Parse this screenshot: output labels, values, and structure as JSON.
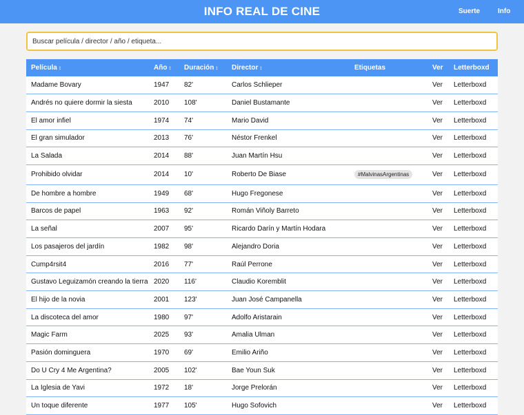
{
  "header": {
    "title": "INFO REAL DE CINE",
    "nav": [
      "Suerte",
      "Info"
    ]
  },
  "search": {
    "placeholder": "Buscar película / director / año / etiqueta..."
  },
  "table": {
    "columns": [
      {
        "label": "Película",
        "sortable": true
      },
      {
        "label": "Año",
        "sortable": true
      },
      {
        "label": "Duración",
        "sortable": true
      },
      {
        "label": "Director",
        "sortable": true
      },
      {
        "label": "Etiquetas",
        "sortable": false
      },
      {
        "label": "Ver",
        "sortable": false
      },
      {
        "label": "Letterboxd",
        "sortable": false
      }
    ],
    "sort_arrow": "↕",
    "rows": [
      {
        "title": "Madame Bovary",
        "year": "1947",
        "duration": "82'",
        "director": "Carlos Schlieper",
        "tags": [],
        "ver": "Ver",
        "letterboxd": "Letterboxd"
      },
      {
        "title": "Andrés no quiere dormir la siesta",
        "year": "2010",
        "duration": "108'",
        "director": "Daniel Bustamante",
        "tags": [],
        "ver": "Ver",
        "letterboxd": "Letterboxd"
      },
      {
        "title": "El amor infiel",
        "year": "1974",
        "duration": "74'",
        "director": "Mario David",
        "tags": [],
        "ver": "Ver",
        "letterboxd": "Letterboxd"
      },
      {
        "title": "El gran simulador",
        "year": "2013",
        "duration": "76'",
        "director": "Néstor Frenkel",
        "tags": [],
        "ver": "Ver",
        "letterboxd": "Letterboxd"
      },
      {
        "title": "La Salada",
        "year": "2014",
        "duration": "88'",
        "director": "Juan Martín Hsu",
        "tags": [],
        "ver": "Ver",
        "letterboxd": "Letterboxd"
      },
      {
        "title": "Prohibido olvidar",
        "year": "2014",
        "duration": "10'",
        "director": "Roberto De Biase",
        "tags": [
          "#MalvinasArgentinas"
        ],
        "ver": "Ver",
        "letterboxd": "Letterboxd"
      },
      {
        "title": "De hombre a hombre",
        "year": "1949",
        "duration": "68'",
        "director": "Hugo Fregonese",
        "tags": [],
        "ver": "Ver",
        "letterboxd": "Letterboxd"
      },
      {
        "title": "Barcos de papel",
        "year": "1963",
        "duration": "92'",
        "director": "Román Viñoly Barreto",
        "tags": [],
        "ver": "Ver",
        "letterboxd": "Letterboxd"
      },
      {
        "title": "La señal",
        "year": "2007",
        "duration": "95'",
        "director": "Ricardo Darín y Martín Hodara",
        "tags": [],
        "ver": "Ver",
        "letterboxd": "Letterboxd"
      },
      {
        "title": "Los pasajeros del jardín",
        "year": "1982",
        "duration": "98'",
        "director": "Alejandro Doria",
        "tags": [],
        "ver": "Ver",
        "letterboxd": "Letterboxd"
      },
      {
        "title": "Cump4rsit4",
        "year": "2016",
        "duration": "77'",
        "director": "Raúl Perrone",
        "tags": [],
        "ver": "Ver",
        "letterboxd": "Letterboxd"
      },
      {
        "title": "Gustavo Leguizamón creando la tierra",
        "year": "2020",
        "duration": "116'",
        "director": "Claudio Koremblit",
        "tags": [],
        "ver": "Ver",
        "letterboxd": "Letterboxd"
      },
      {
        "title": "El hijo de la novia",
        "year": "2001",
        "duration": "123'",
        "director": "Juan José Campanella",
        "tags": [],
        "ver": "Ver",
        "letterboxd": "Letterboxd"
      },
      {
        "title": "La discoteca del amor",
        "year": "1980",
        "duration": "97'",
        "director": "Adolfo Aristarain",
        "tags": [],
        "ver": "Ver",
        "letterboxd": "Letterboxd"
      },
      {
        "title": "Magic Farm",
        "year": "2025",
        "duration": "93'",
        "director": "Amalia Ulman",
        "tags": [],
        "ver": "Ver",
        "letterboxd": "Letterboxd"
      },
      {
        "title": "Pasión dominguera",
        "year": "1970",
        "duration": "69'",
        "director": "Emilio Ariño",
        "tags": [],
        "ver": "Ver",
        "letterboxd": "Letterboxd"
      },
      {
        "title": "Do U Cry 4 Me Argentina?",
        "year": "2005",
        "duration": "102'",
        "director": "Bae Youn Suk",
        "tags": [],
        "ver": "Ver",
        "letterboxd": "Letterboxd"
      },
      {
        "title": "La Iglesia de Yavi",
        "year": "1972",
        "duration": "18'",
        "director": "Jorge Prelorán",
        "tags": [],
        "ver": "Ver",
        "letterboxd": "Letterboxd"
      },
      {
        "title": "Un toque diferente",
        "year": "1977",
        "duration": "105'",
        "director": "Hugo Sofovich",
        "tags": [],
        "ver": "Ver",
        "letterboxd": "Letterboxd"
      }
    ]
  }
}
